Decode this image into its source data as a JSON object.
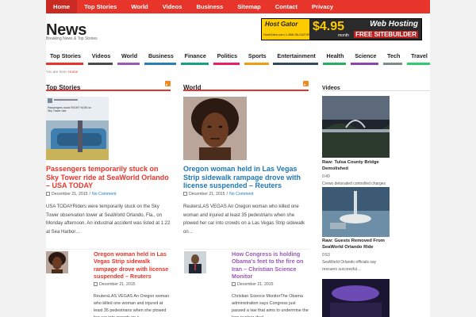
{
  "topnav": [
    "Home",
    "Top Stories",
    "World",
    "Videos",
    "Business",
    "Sitemap",
    "Contact",
    "Privacy"
  ],
  "site": {
    "title": "News",
    "tagline": "Breaking News & Top Stories"
  },
  "ad": {
    "brand": "Host Gator",
    "phone": "HostGator.com 1-866-96-GATOR",
    "price": "$4.95",
    "period": "month",
    "headline": "Web Hosting",
    "offer": "FREE SITEBUILDER"
  },
  "catnav": [
    {
      "label": "Top Stories",
      "color": "#e8352b"
    },
    {
      "label": "Videos",
      "color": "#4a4a4a"
    },
    {
      "label": "World",
      "color": "#9b59b6"
    },
    {
      "label": "Business",
      "color": "#2980b9"
    },
    {
      "label": "Finance",
      "color": "#16a085"
    },
    {
      "label": "Politics",
      "color": "#e91e63"
    },
    {
      "label": "Sports",
      "color": "#f39c12"
    },
    {
      "label": "Entertainment",
      "color": "#34495e"
    },
    {
      "label": "Health",
      "color": "#27ae60"
    },
    {
      "label": "Science",
      "color": "#8e44ad"
    },
    {
      "label": "Tech",
      "color": "#7f8c8d"
    },
    {
      "label": "Travel",
      "color": "#2ecc71"
    }
  ],
  "breadcrumb": {
    "prefix": "You are here:",
    "link": "Home"
  },
  "sections": {
    "top": "Top Stories",
    "world": "World",
    "videos": "Videos"
  },
  "top_story": {
    "title": "Passengers temporarily stuck on Sky Tower ride at SeaWorld Orlando – USA TODAY",
    "date": "December 21, 2015",
    "comments": "No Comment",
    "excerpt": "USA TODAYRiders were temporarily stuck on the Sky Tower observation tower at SeaWorld Orlando, Fla., on Monday afternoon. An industrial accident was listed at 1:22 at Sea Harbor…"
  },
  "world_story": {
    "title": "Oregon woman held in Las Vegas Strip sidewalk rampage drove with license suspended – Reuters",
    "date": "December 21, 2015",
    "comments": "No Comment",
    "excerpt": "ReutersLAS VEGAS An Oregon woman who killed one woman and injured at least 35 pedestrians when she plowed her car into crowds on a Las Vegas Strip sidewalk on…"
  },
  "small_left": {
    "title": "Oregon woman held in Las Vegas Strip sidewalk rampage drove with license suspended – Reuters",
    "date": "December 21, 2015",
    "excerpt": "ReutersLAS VEGAS An Oregon woman who killed one woman and injured at least 35 pedestrians when she plowed her car into crowds on a"
  },
  "small_right": {
    "title": "How Congress is holding Obama's feet to the fire on Iran – Christian Science Monitor",
    "date": "December 21, 2015",
    "excerpt": "Christian Science MonitorThe Obama administration says Congress just passed a law that aims to undermine the Iran nuclear deal"
  },
  "thumb_caption": "Passengers stuck RIGHT NOW on Sky Tower ride",
  "videos": [
    {
      "title": "Raw: Tulsa County Bridge Demolished",
      "duration": "0:40",
      "text": "Crews detonated controlled charges on the center s…"
    },
    {
      "title": "Raw: Guests Removed From SeaWorld Orlando Ride",
      "duration": "0:53",
      "text": "SeaWorld Orlando officials say rescuers successful…"
    }
  ]
}
